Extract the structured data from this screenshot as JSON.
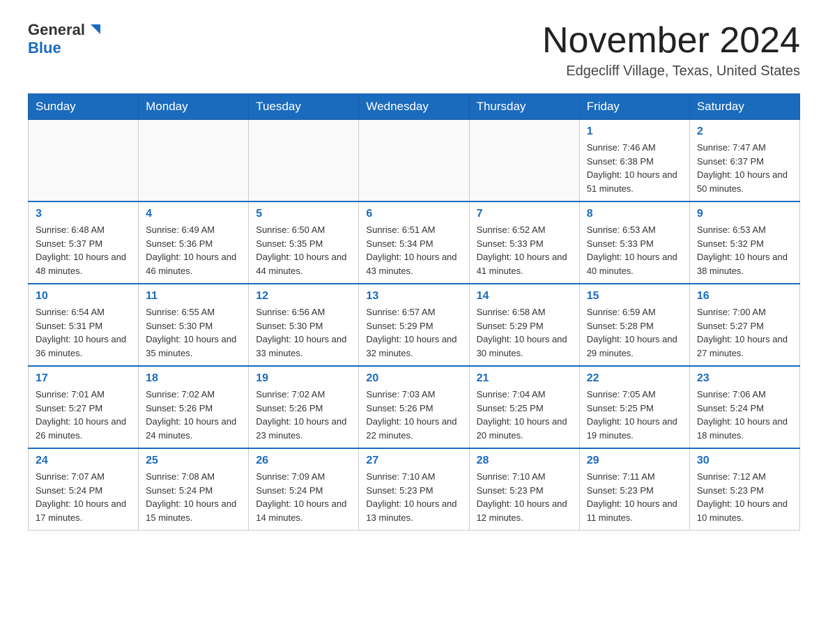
{
  "header": {
    "logo_general": "General",
    "logo_blue": "Blue",
    "month_title": "November 2024",
    "location": "Edgecliff Village, Texas, United States"
  },
  "weekdays": [
    "Sunday",
    "Monday",
    "Tuesday",
    "Wednesday",
    "Thursday",
    "Friday",
    "Saturday"
  ],
  "weeks": [
    [
      {
        "day": "",
        "info": ""
      },
      {
        "day": "",
        "info": ""
      },
      {
        "day": "",
        "info": ""
      },
      {
        "day": "",
        "info": ""
      },
      {
        "day": "",
        "info": ""
      },
      {
        "day": "1",
        "info": "Sunrise: 7:46 AM\nSunset: 6:38 PM\nDaylight: 10 hours and 51 minutes."
      },
      {
        "day": "2",
        "info": "Sunrise: 7:47 AM\nSunset: 6:37 PM\nDaylight: 10 hours and 50 minutes."
      }
    ],
    [
      {
        "day": "3",
        "info": "Sunrise: 6:48 AM\nSunset: 5:37 PM\nDaylight: 10 hours and 48 minutes."
      },
      {
        "day": "4",
        "info": "Sunrise: 6:49 AM\nSunset: 5:36 PM\nDaylight: 10 hours and 46 minutes."
      },
      {
        "day": "5",
        "info": "Sunrise: 6:50 AM\nSunset: 5:35 PM\nDaylight: 10 hours and 44 minutes."
      },
      {
        "day": "6",
        "info": "Sunrise: 6:51 AM\nSunset: 5:34 PM\nDaylight: 10 hours and 43 minutes."
      },
      {
        "day": "7",
        "info": "Sunrise: 6:52 AM\nSunset: 5:33 PM\nDaylight: 10 hours and 41 minutes."
      },
      {
        "day": "8",
        "info": "Sunrise: 6:53 AM\nSunset: 5:33 PM\nDaylight: 10 hours and 40 minutes."
      },
      {
        "day": "9",
        "info": "Sunrise: 6:53 AM\nSunset: 5:32 PM\nDaylight: 10 hours and 38 minutes."
      }
    ],
    [
      {
        "day": "10",
        "info": "Sunrise: 6:54 AM\nSunset: 5:31 PM\nDaylight: 10 hours and 36 minutes."
      },
      {
        "day": "11",
        "info": "Sunrise: 6:55 AM\nSunset: 5:30 PM\nDaylight: 10 hours and 35 minutes."
      },
      {
        "day": "12",
        "info": "Sunrise: 6:56 AM\nSunset: 5:30 PM\nDaylight: 10 hours and 33 minutes."
      },
      {
        "day": "13",
        "info": "Sunrise: 6:57 AM\nSunset: 5:29 PM\nDaylight: 10 hours and 32 minutes."
      },
      {
        "day": "14",
        "info": "Sunrise: 6:58 AM\nSunset: 5:29 PM\nDaylight: 10 hours and 30 minutes."
      },
      {
        "day": "15",
        "info": "Sunrise: 6:59 AM\nSunset: 5:28 PM\nDaylight: 10 hours and 29 minutes."
      },
      {
        "day": "16",
        "info": "Sunrise: 7:00 AM\nSunset: 5:27 PM\nDaylight: 10 hours and 27 minutes."
      }
    ],
    [
      {
        "day": "17",
        "info": "Sunrise: 7:01 AM\nSunset: 5:27 PM\nDaylight: 10 hours and 26 minutes."
      },
      {
        "day": "18",
        "info": "Sunrise: 7:02 AM\nSunset: 5:26 PM\nDaylight: 10 hours and 24 minutes."
      },
      {
        "day": "19",
        "info": "Sunrise: 7:02 AM\nSunset: 5:26 PM\nDaylight: 10 hours and 23 minutes."
      },
      {
        "day": "20",
        "info": "Sunrise: 7:03 AM\nSunset: 5:26 PM\nDaylight: 10 hours and 22 minutes."
      },
      {
        "day": "21",
        "info": "Sunrise: 7:04 AM\nSunset: 5:25 PM\nDaylight: 10 hours and 20 minutes."
      },
      {
        "day": "22",
        "info": "Sunrise: 7:05 AM\nSunset: 5:25 PM\nDaylight: 10 hours and 19 minutes."
      },
      {
        "day": "23",
        "info": "Sunrise: 7:06 AM\nSunset: 5:24 PM\nDaylight: 10 hours and 18 minutes."
      }
    ],
    [
      {
        "day": "24",
        "info": "Sunrise: 7:07 AM\nSunset: 5:24 PM\nDaylight: 10 hours and 17 minutes."
      },
      {
        "day": "25",
        "info": "Sunrise: 7:08 AM\nSunset: 5:24 PM\nDaylight: 10 hours and 15 minutes."
      },
      {
        "day": "26",
        "info": "Sunrise: 7:09 AM\nSunset: 5:24 PM\nDaylight: 10 hours and 14 minutes."
      },
      {
        "day": "27",
        "info": "Sunrise: 7:10 AM\nSunset: 5:23 PM\nDaylight: 10 hours and 13 minutes."
      },
      {
        "day": "28",
        "info": "Sunrise: 7:10 AM\nSunset: 5:23 PM\nDaylight: 10 hours and 12 minutes."
      },
      {
        "day": "29",
        "info": "Sunrise: 7:11 AM\nSunset: 5:23 PM\nDaylight: 10 hours and 11 minutes."
      },
      {
        "day": "30",
        "info": "Sunrise: 7:12 AM\nSunset: 5:23 PM\nDaylight: 10 hours and 10 minutes."
      }
    ]
  ]
}
